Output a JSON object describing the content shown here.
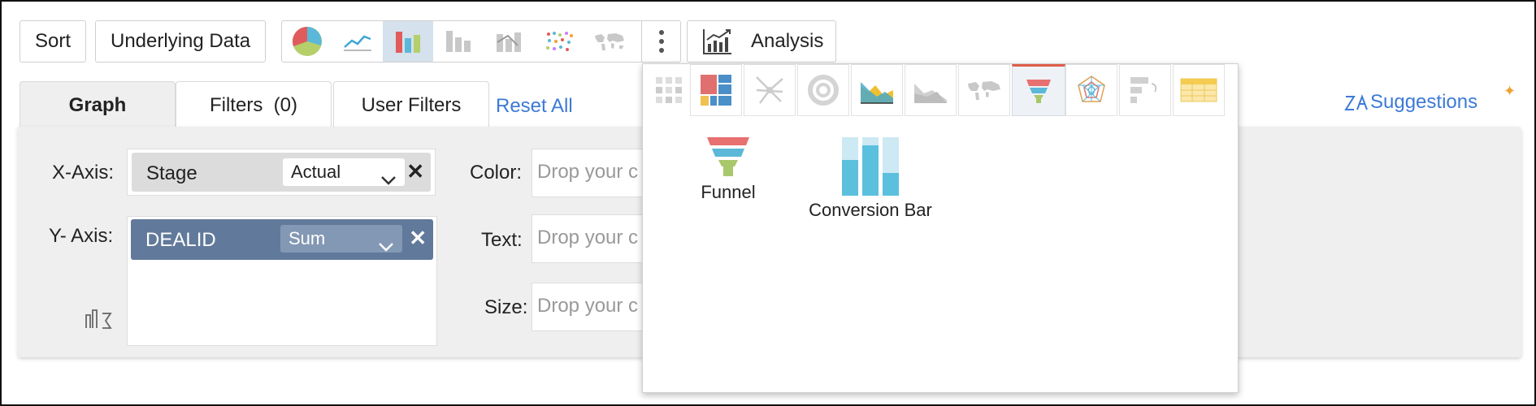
{
  "toolbar": {
    "sort_label": "Sort",
    "underlying_label": "Underlying Data",
    "chart_types": [
      "pie-chart-icon",
      "line-chart-icon",
      "bar-chart-icon",
      "stacked-bar-icon",
      "combo-chart-icon",
      "scatter-chart-icon",
      "geo-map-icon"
    ],
    "selected_chart_type": "bar-chart-icon",
    "more_icon": "more-vert-icon",
    "analysis_label": "Analysis"
  },
  "tabs": {
    "graph": "Graph",
    "filters": "Filters",
    "filters_count": "(0)",
    "user_filters": "User Filters",
    "reset_all": "Reset All"
  },
  "suggestions": {
    "label": "Suggestions"
  },
  "axes": {
    "x_label": "X-Axis:",
    "x_field": "Stage",
    "x_agg": "Actual",
    "y_label": "Y- Axis:",
    "y_field": "DEALID",
    "y_agg": "Sum"
  },
  "shelves": {
    "color_label": "Color:",
    "text_label": "Text:",
    "size_label": "Size:",
    "placeholder": "Drop your c"
  },
  "chart_picker": {
    "strip_icons": [
      "pivot-dots-icon",
      "treemap-icon",
      "web-chart-icon",
      "donut-icon",
      "area-chart-icon",
      "area-gray-icon",
      "map-icon",
      "funnel-icon",
      "radar-icon",
      "process-icon",
      "table-icon"
    ],
    "selected": "funnel-icon",
    "options": [
      {
        "label": "Funnel",
        "icon": "funnel-icon"
      },
      {
        "label": "Conversion Bar",
        "icon": "conversion-bar-icon"
      }
    ]
  },
  "colors": {
    "accent_link": "#3c7ad6",
    "pill_dimension": "#dcdcdc",
    "pill_measure": "#61799a",
    "selected_tab": "#e05c47"
  }
}
